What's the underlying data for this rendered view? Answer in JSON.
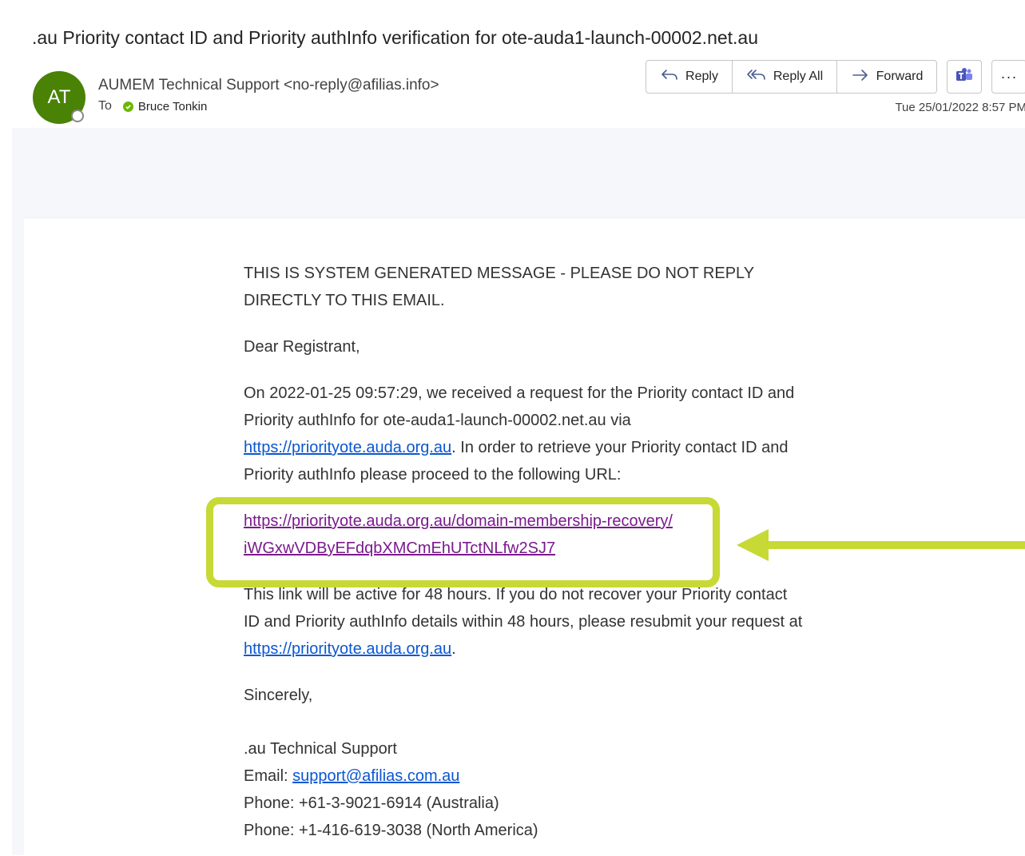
{
  "email": {
    "subject": ".au Priority contact ID and Priority authInfo verification for ote-auda1-launch-00002.net.au",
    "avatar_initials": "AT",
    "sender": "AUMEM Technical Support <no-reply@afilias.info>",
    "to_label": "To",
    "recipient": "Bruce Tonkin",
    "date": "Tue 25/01/2022 8:57 PM"
  },
  "actions": {
    "reply": "Reply",
    "reply_all": "Reply All",
    "forward": "Forward",
    "more": "···"
  },
  "body": {
    "notice": "THIS IS SYSTEM GENERATED MESSAGE - PLEASE DO NOT REPLY DIRECTLY TO THIS EMAIL.",
    "greeting": "Dear Registrant,",
    "para1_before": "On 2022-01-25 09:57:29, we received a request for the Priority contact ID and Priority authInfo for ote-auda1-launch-00002.net.au via ",
    "para1_link": "https://priorityote.auda.org.au",
    "para1_after": ". In order to retrieve your Priority contact ID and Priority authInfo please proceed to the following URL:",
    "recovery_link": "https://priorityote.auda.org.au/domain-membership-recovery/iWGxwVDByEFdqbXMCmEhUTctNLfw2SJ7",
    "para2_before": "This link will be active for 48 hours. If you do not recover your Priority contact ID and Priority authInfo details within 48 hours, please resubmit your request at ",
    "para2_link": "https://priorityote.auda.org.au",
    "para2_after": ".",
    "closing": "Sincerely,",
    "signature_name": ".au Technical Support",
    "email_label": "Email: ",
    "email_link": "support@afilias.com.au",
    "phone_au": "Phone: +61-3-9021-6914 (Australia)",
    "phone_na": "Phone: +1-416-619-3038 (North America)"
  },
  "colors": {
    "highlight": "#c7d934",
    "link": "#0b57d0",
    "visited_link": "#7a1a8c",
    "avatar": "#498205"
  }
}
